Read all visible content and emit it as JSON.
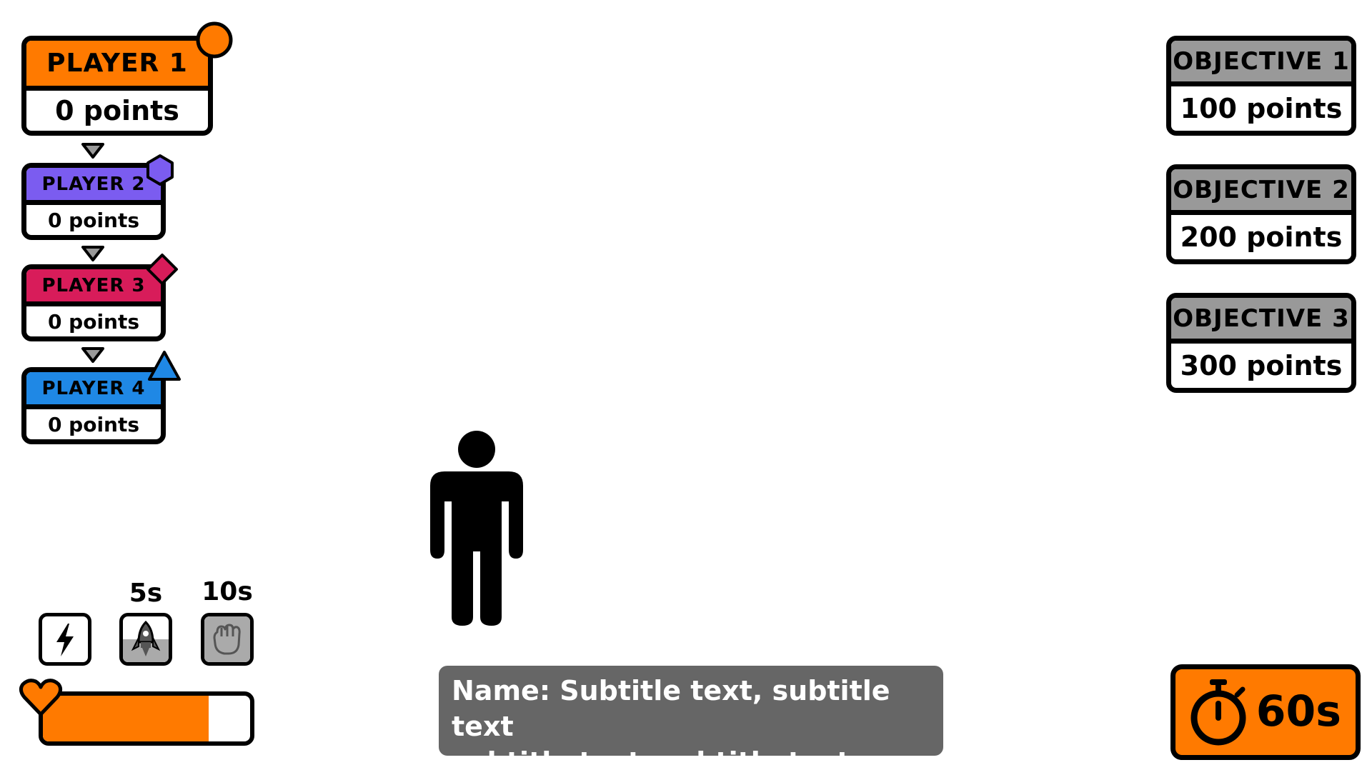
{
  "players": [
    {
      "name": "PLAYER 1",
      "score": "0 points",
      "color": "#ff7a00",
      "badge": "circle-badge-icon"
    },
    {
      "name": "PLAYER 2",
      "score": "0 points",
      "color": "#7b5cf0",
      "badge": "hexagon-badge-icon"
    },
    {
      "name": "PLAYER 3",
      "score": "0 points",
      "color": "#d81c5a",
      "badge": "diamond-badge-icon"
    },
    {
      "name": "PLAYER 4",
      "score": "0 points",
      "color": "#1f88e5",
      "badge": "triangle-badge-icon"
    }
  ],
  "objectives": [
    {
      "name": "OBJECTIVE 1",
      "points": "100 points"
    },
    {
      "name": "OBJECTIVE 2",
      "points": "200 points"
    },
    {
      "name": "OBJECTIVE 3",
      "points": "300 points"
    }
  ],
  "abilities": [
    {
      "icon": "lightning-icon",
      "cooldown": "",
      "cooldown_fraction": 0
    },
    {
      "icon": "rocket-icon",
      "cooldown": "5s",
      "cooldown_fraction": 0.5
    },
    {
      "icon": "fist-icon",
      "cooldown": "10s",
      "cooldown_fraction": 1
    }
  ],
  "health": {
    "icon": "heart-icon",
    "fraction": 0.8
  },
  "subtitle": {
    "line1": "Name: Subtitle text, subtitle text",
    "line2": "subtitle text, subtitle text"
  },
  "timer": {
    "icon": "stopwatch-icon",
    "value": "60s"
  },
  "character": {
    "icon": "person-icon"
  },
  "colors": {
    "accent": "#ff7a00",
    "objective_header": "#999999",
    "subtitle_bg": "#666666",
    "cooldown_fill": "#aaaaaa"
  }
}
